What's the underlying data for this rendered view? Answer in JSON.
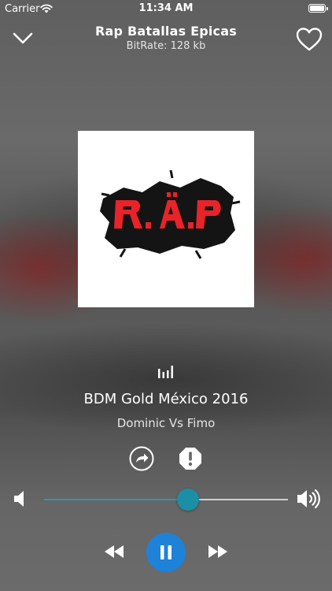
{
  "status_bar": {
    "carrier": "Carrier",
    "time": "11:34 AM",
    "battery_percent": 100
  },
  "header": {
    "title": "Rap Batallas Epicas",
    "bitrate": "BitRate: 128 kb"
  },
  "artwork": {
    "logo_text": "R.A.P",
    "logo_color": "#e8232a"
  },
  "track": {
    "title": "BDM Gold México 2016",
    "artist": "Dominic Vs Fimo"
  },
  "volume": {
    "level": 0.59
  },
  "colors": {
    "accent": "#1b8fa6",
    "play_button": "#1e82d8"
  },
  "icons": [
    "wifi-icon",
    "battery-icon",
    "chevron-down-icon",
    "heart-icon",
    "equalizer-icon",
    "share-icon",
    "report-icon",
    "volume-low-icon",
    "volume-high-icon",
    "rewind-icon",
    "pause-icon",
    "fast-forward-icon"
  ]
}
